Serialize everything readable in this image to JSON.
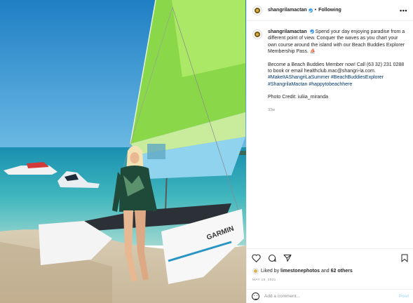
{
  "post": {
    "username": "shangrilamactan",
    "separator": "•",
    "follow_state": "Following",
    "more_icon": "•••",
    "caption_text": "Spend your day enjoying paradise from a different point of view. Conquer the waves as you chart your own course around the island with our Beach Buddies Explorer Membership Pass. ⛵",
    "caption_para2": "Become a Beach Buddies Member now! Call (63 32) 231 0288 to book or email healthclub.mac@shangri-la.com.",
    "hashtags": [
      "#MakeItAShangriLaSummer",
      "#BeachBuddiesExplorer",
      "#ShangrilaMactan",
      "#happytobeachhere"
    ],
    "photo_credit": "Photo Credit: iuliia_miranda",
    "age": "33w",
    "likes_prefix": "Liked by",
    "liked_by_user": "limestonephotos",
    "likes_and": "and",
    "likes_others": "62 others",
    "date": "MAY 18, 2021",
    "comment_placeholder": "Add a comment...",
    "post_label": "Post",
    "photo_boat_brand": "GARMIN"
  },
  "colors": {
    "link": "#00376b",
    "verified": "#3897f0",
    "post_disabled": "#b2dffc",
    "sail_green": "#8ad84a",
    "sail_blue": "#8fd3ee",
    "sky": "#2f8fcf",
    "sea": "#2fa5b3"
  },
  "icons": [
    "avatar-logo-icon",
    "verified-badge-icon",
    "more-options-icon",
    "heart-icon",
    "comment-icon",
    "share-icon",
    "bookmark-icon",
    "emoji-icon"
  ]
}
